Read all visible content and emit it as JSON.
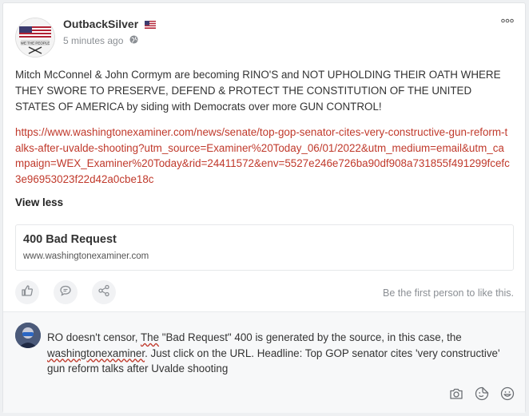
{
  "post": {
    "author": "OutbackSilver",
    "time": "5 minutes ago",
    "text": "Mitch McConnel & John Cormym are becoming RINO'S and NOT UPHOLDING THEIR OATH WHERE THEY SWORE TO PRESERVE, DEFEND & PROTECT THE CONSTITUTION OF THE UNITED STATES OF AMERICA by siding with Democrats over more GUN CONTROL!",
    "link": "https://www.washingtonexaminer.com/news/senate/top-gop-senator-cites-very-constructive-gun-reform-talks-after-uvalde-shooting?utm_source=Examiner%20Today_06/01/2022&utm_medium=email&utm_campaign=WEX_Examiner%20Today&rid=24411572&env=5527e246e726ba90df908a731855f491299fcefc3e96953023f22d42a0cbe18c",
    "view_less": "View less",
    "preview": {
      "title": "400 Bad Request",
      "domain": "www.washingtonexaminer.com"
    },
    "like_note": "Be the first person to like this."
  },
  "comment": {
    "part1": "RO doesn't censor, ",
    "the": "The",
    "part2": " \"Bad Request\" 400 is generated by the source, in this case, the ",
    "source": "washingtonexaminer",
    "part3": ". Just click on the URL. Headline: Top GOP senator cites 'very constructive' gun reform talks after Uvalde shooting"
  },
  "avatar_text": {
    "banner": "WE THE PEOPLE"
  },
  "colors": {
    "link": "#c0392b",
    "icon": "#8b8f94",
    "background": "#eef0f2"
  },
  "icons": [
    "more-icon",
    "globe-icon",
    "like-icon",
    "comment-icon",
    "share-icon",
    "camera-icon",
    "sticker-icon",
    "emoji-icon"
  ]
}
